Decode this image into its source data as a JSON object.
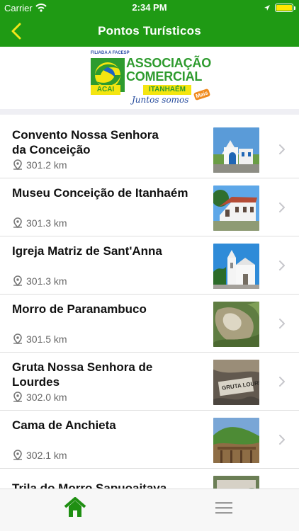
{
  "status": {
    "carrier": "Carrier",
    "time": "2:34 PM"
  },
  "header": {
    "title": "Pontos Turísticos"
  },
  "logo": {
    "small": "FILIADA A FACESP",
    "line1": "ASSOCIAÇÃO",
    "line2": "COMERCIAL",
    "left_band": "ACAI",
    "right_band": "ITANHAÉM",
    "tagline": "Juntos somos",
    "badge": "Mais"
  },
  "items": [
    {
      "title": "Convento Nossa Senhora\nda Conceição",
      "distance": "301.2 km"
    },
    {
      "title": "Museu Conceição de Itanhaém",
      "distance": "301.3 km"
    },
    {
      "title": "Igreja Matriz de Sant'Anna",
      "distance": "301.3 km"
    },
    {
      "title": "Morro de Paranambuco",
      "distance": "301.5 km"
    },
    {
      "title": "Gruta Nossa Senhora de Lourdes",
      "distance": "302.0 km"
    },
    {
      "title": "Cama de Anchieta",
      "distance": "302.1 km"
    },
    {
      "title": "Trila do Morro Sapuoaitava",
      "distance": ""
    }
  ],
  "thumbnail_captions": {
    "cave_sign": "GRUTA LOURDES"
  },
  "colors": {
    "brand_green": "#1f9a14",
    "active_tab": "#1f8f12",
    "inactive_tab": "#9b9b9b"
  },
  "icons": [
    "wifi-icon",
    "back-icon",
    "location-pin-icon",
    "chevron-right-icon",
    "home-icon",
    "menu-icon"
  ]
}
